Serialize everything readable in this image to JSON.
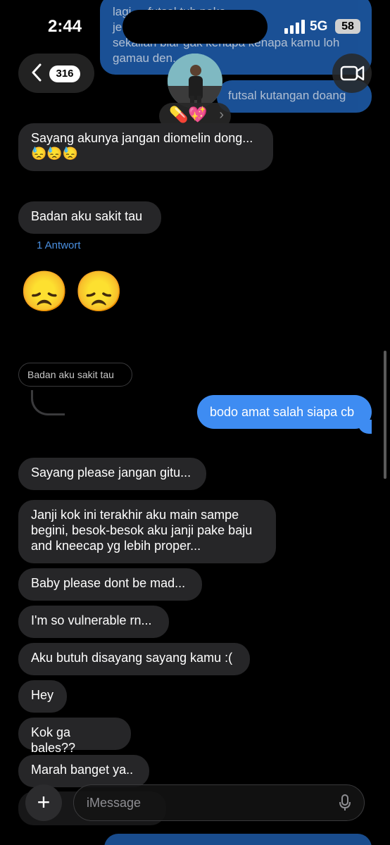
{
  "status": {
    "time": "2:44",
    "network": "5G",
    "battery": "58"
  },
  "header": {
    "back_count": "316",
    "contact_emoji": "💊💖",
    "contact_chevron": "›"
  },
  "top_messages": {
    "lines": [
      "lagi ...  futsal tuh pake",
      "je...                     ake...",
      "sekalian biar gak kenapa kenapa kamu loh",
      "gamau den... aku"
    ],
    "second": "futsal kutangan doang"
  },
  "messages": {
    "m1_line1": "Sayang akunya jangan diomelin dong...",
    "m1_line2": "😓😓😓",
    "m2": "Badan aku sakit tau",
    "m2_reply": "1 Antwort",
    "emojis": "😞😞",
    "quoted": "Badan aku sakit tau",
    "sent": "bodo amat salah siapa cb",
    "m3": "Sayang please jangan gitu...",
    "m4_line1": "Janji kok ini terakhir aku main sampe",
    "m4_line2": "begini, besok-besok aku janji pake baju",
    "m4_line3": "and kneecap yg lebih proper...",
    "m5": "Baby please dont be mad...",
    "m6": "I'm so vulnerable rn...",
    "m7": "Aku butuh disayang sayang kamu :(",
    "m8": "Hey",
    "m9": "Kok ga bales??",
    "m10": "Marah banget ya.."
  },
  "composer": {
    "plus": "+",
    "placeholder": "iMessage"
  }
}
